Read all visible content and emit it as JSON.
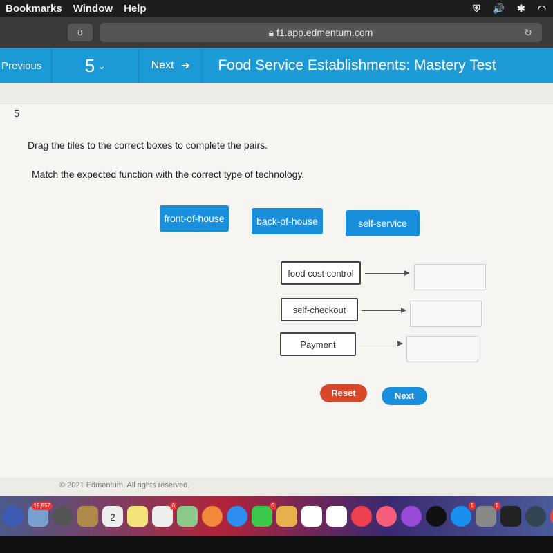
{
  "menubar": {
    "items": [
      "Bookmarks",
      "Window",
      "Help"
    ]
  },
  "browser": {
    "url": "f1.app.edmentum.com"
  },
  "nav": {
    "previous": "Previous",
    "question_number": "5",
    "next": "Next",
    "title": "Food Service Establishments: Mastery Test"
  },
  "question": {
    "number": "5",
    "instruction": "Drag the tiles to the correct boxes to complete the pairs.",
    "prompt": "Match the expected function with the correct type of technology.",
    "tiles": [
      "front-of-house",
      "back-of-house",
      "self-service"
    ],
    "terms": [
      "food cost control",
      "self-checkout",
      "Payment"
    ]
  },
  "buttons": {
    "reset": "Reset",
    "next": "Next"
  },
  "colors": {
    "accent": "#1c9ad6",
    "reset": "#d9472b",
    "next": "#1a8fdc"
  },
  "footer": "© 2021 Edmentum. All rights reserved.",
  "dock": {
    "badges": [
      "19,957",
      "6",
      "6",
      "1",
      "1"
    ],
    "calendar_day": "2"
  }
}
